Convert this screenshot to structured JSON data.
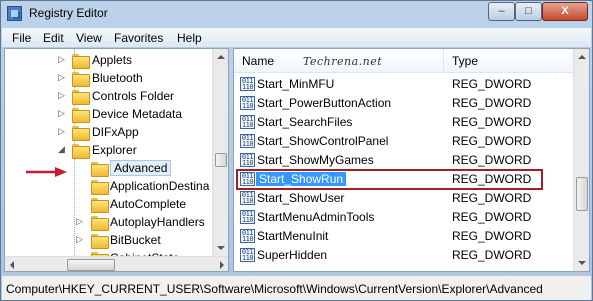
{
  "window": {
    "title": "Registry Editor"
  },
  "window_controls": {
    "minimize": "–",
    "maximize": "□",
    "close": "X"
  },
  "menu": [
    "File",
    "Edit",
    "View",
    "Favorites",
    "Help"
  ],
  "tree": {
    "items": [
      {
        "label": "Applets",
        "expander": "▷",
        "selected": false
      },
      {
        "label": "Bluetooth",
        "expander": "▷",
        "selected": false
      },
      {
        "label": "Controls Folder",
        "expander": "▷",
        "selected": false
      },
      {
        "label": "Device Metadata",
        "expander": "▷",
        "selected": false
      },
      {
        "label": "DIFxApp",
        "expander": "▷",
        "selected": false
      },
      {
        "label": "Explorer",
        "expander": "◢",
        "selected": false
      },
      {
        "label": "Advanced",
        "expander": "",
        "selected": true
      },
      {
        "label": "ApplicationDestina",
        "expander": "",
        "selected": false
      },
      {
        "label": "AutoComplete",
        "expander": "",
        "selected": false
      },
      {
        "label": "AutoplayHandlers",
        "expander": "▷",
        "selected": false
      },
      {
        "label": "BitBucket",
        "expander": "▷",
        "selected": false
      },
      {
        "label": "CabinetState",
        "expander": "",
        "selected": false
      }
    ]
  },
  "list": {
    "columns": {
      "name": "Name",
      "type": "Type"
    },
    "watermark": "Techrena.net",
    "icon_text": "011\n110",
    "rows": [
      {
        "name": "Start_MinMFU",
        "type": "REG_DWORD",
        "selected": false
      },
      {
        "name": "Start_PowerButtonAction",
        "type": "REG_DWORD",
        "selected": false
      },
      {
        "name": "Start_SearchFiles",
        "type": "REG_DWORD",
        "selected": false
      },
      {
        "name": "Start_ShowControlPanel",
        "type": "REG_DWORD",
        "selected": false
      },
      {
        "name": "Start_ShowMyGames",
        "type": "REG_DWORD",
        "selected": false
      },
      {
        "name": "Start_ShowRun",
        "type": "REG_DWORD",
        "selected": true
      },
      {
        "name": "Start_ShowUser",
        "type": "REG_DWORD",
        "selected": false
      },
      {
        "name": "StartMenuAdminTools",
        "type": "REG_DWORD",
        "selected": false
      },
      {
        "name": "StartMenuInit",
        "type": "REG_DWORD",
        "selected": false
      },
      {
        "name": "SuperHidden",
        "type": "REG_DWORD",
        "selected": false
      }
    ]
  },
  "status": {
    "path": "Computer\\HKEY_CURRENT_USER\\Software\\Microsoft\\Windows\\CurrentVersion\\Explorer\\Advanced"
  },
  "colors": {
    "selection": "#3399ff",
    "highlight_box": "#a31d24",
    "arrow": "#c0202a"
  }
}
